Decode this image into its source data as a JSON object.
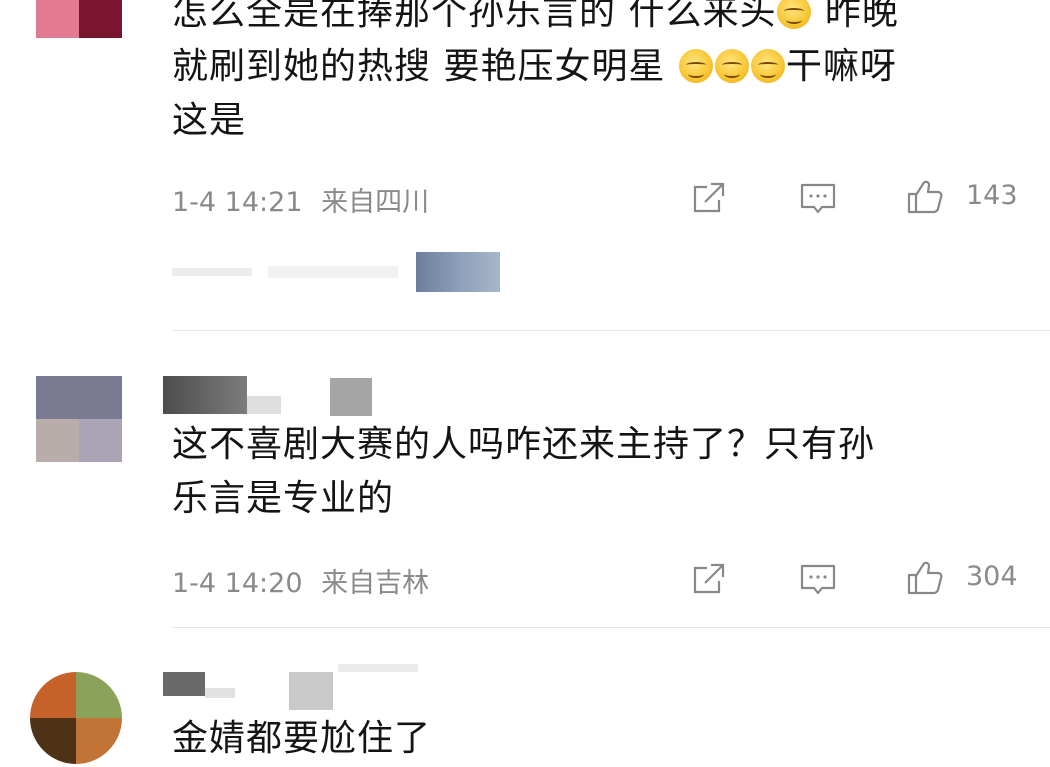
{
  "comments": [
    {
      "text_lines": [
        "怎么全是在捧那个孙乐言的 什么来头",
        "昨晚",
        "就刷到她的热搜 要艳压女明星",
        "干嘛呀",
        "这是"
      ],
      "time": "1-4 14:21",
      "location": "来自四川",
      "likes": "143",
      "emoji": "grinning-sweat-emoji"
    },
    {
      "text_lines": [
        "这不喜剧大赛的人吗咋还来主持了？只有孙",
        "乐言是专业的"
      ],
      "time": "1-4 14:20",
      "location": "来自吉林",
      "likes": "304"
    },
    {
      "text_lines": [
        "金婧都要尬住了"
      ]
    }
  ],
  "icons": {
    "share": "share-icon",
    "reply": "comment-icon",
    "like": "thumbs-up-icon"
  },
  "colors": {
    "text": "#141414",
    "meta": "#8a8a8a",
    "divider": "#e6e6e6",
    "emoji": "#f7c531"
  }
}
